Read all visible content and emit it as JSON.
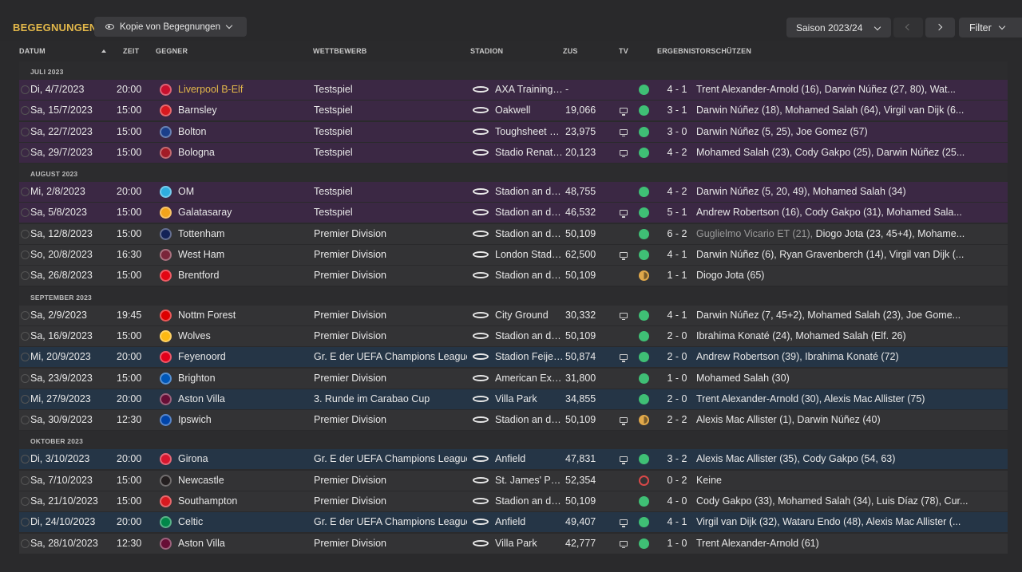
{
  "header": {
    "title": "BEGEGNUNGEN",
    "view_label": "Kopie von Begegnungen",
    "season_label": "Saison 2023/24",
    "filter_label": "Filter"
  },
  "columns": {
    "date": "DATUM",
    "time": "ZEIT",
    "opponent": "GEGNER",
    "competition": "WETTBEWERB",
    "stadium": "STADION",
    "attendance": "ZUS",
    "tv": "TV",
    "result": "ERGEBNIS",
    "scorers": "TORSCHÜTZEN"
  },
  "colors": {
    "friendly_row": "#3b2844",
    "league_row": "#333335",
    "cup_row": "#253546",
    "win": "#3fbf75",
    "draw": "#e0a84a",
    "loss": "#d84848",
    "accent": "#e3b84a"
  },
  "months": [
    {
      "label": "JULI 2023",
      "matches": [
        {
          "date": "Di, 4/7/2023",
          "time": "20:00",
          "opponent": "Liverpool B-Elf",
          "opponent_highlight": true,
          "crest_color": "#c8102e",
          "competition": "Testspiel",
          "kind": "friendly",
          "stadium": "AXA Training Centre",
          "attendance": "-",
          "tv": false,
          "result": "win",
          "score": "4 - 1",
          "scorers": "Trent Alexander-Arnold (16), Darwin Núñez (27, 80), Wat..."
        },
        {
          "date": "Sa, 15/7/2023",
          "time": "15:00",
          "opponent": "Barnsley",
          "crest_color": "#d71920",
          "competition": "Testspiel",
          "kind": "friendly",
          "stadium": "Oakwell",
          "attendance": "19,066",
          "tv": true,
          "result": "win",
          "score": "3 - 1",
          "scorers": "Darwin Núñez (18), Mohamed Salah (64), Virgil van Dijk (6..."
        },
        {
          "date": "Sa, 22/7/2023",
          "time": "15:00",
          "opponent": "Bolton",
          "crest_color": "#1b3f8b",
          "competition": "Testspiel",
          "kind": "friendly",
          "stadium": "Toughsheet Community Stadium",
          "attendance": "23,975",
          "tv": true,
          "result": "win",
          "score": "3 - 0",
          "scorers": "Darwin Núñez (5, 25), Joe Gomez (57)"
        },
        {
          "date": "Sa, 29/7/2023",
          "time": "15:00",
          "opponent": "Bologna",
          "crest_color": "#a21c26",
          "competition": "Testspiel",
          "kind": "friendly",
          "stadium": "Stadio Renato Dall'Ara",
          "attendance": "20,123",
          "tv": true,
          "result": "win",
          "score": "4 - 2",
          "scorers": "Mohamed Salah (23), Cody Gakpo (25), Darwin Núñez (25..."
        }
      ]
    },
    {
      "label": "AUGUST 2023",
      "matches": [
        {
          "date": "Mi, 2/8/2023",
          "time": "20:00",
          "opponent": "OM",
          "crest_color": "#2faee0",
          "competition": "Testspiel",
          "kind": "friendly",
          "stadium": "Stadion an der Anfield Road",
          "attendance": "48,755",
          "tv": false,
          "result": "win",
          "score": "4 - 2",
          "scorers": "Darwin Núñez (5, 20, 49), Mohamed Salah (34)"
        },
        {
          "date": "Sa, 5/8/2023",
          "time": "15:00",
          "opponent": "Galatasaray",
          "crest_color": "#f2a31b",
          "competition": "Testspiel",
          "kind": "friendly",
          "stadium": "Stadion an der Anfield Road",
          "attendance": "46,532",
          "tv": true,
          "result": "win",
          "score": "5 - 1",
          "scorers": "Andrew Robertson (16), Cody Gakpo (31), Mohamed Sala..."
        },
        {
          "date": "Sa, 12/8/2023",
          "time": "15:00",
          "opponent": "Tottenham",
          "crest_color": "#132257",
          "competition": "Premier Division",
          "kind": "league",
          "stadium": "Stadion an der Anfield Road",
          "attendance": "50,109",
          "tv": false,
          "result": "win",
          "score": "6 - 2",
          "own_goal": "Guglielmo Vicario ET (21), ",
          "scorers": "Diogo Jota (23, 45+4), Mohame..."
        },
        {
          "date": "So, 20/8/2023",
          "time": "16:30",
          "opponent": "West Ham",
          "crest_color": "#7a263a",
          "competition": "Premier Division",
          "kind": "league",
          "stadium": "London Stadium",
          "attendance": "62,500",
          "tv": true,
          "result": "win",
          "score": "4 - 1",
          "scorers": "Darwin Núñez (6), Ryan Gravenberch (14), Virgil van Dijk (..."
        },
        {
          "date": "Sa, 26/8/2023",
          "time": "15:00",
          "opponent": "Brentford",
          "crest_color": "#e30613",
          "competition": "Premier Division",
          "kind": "league",
          "stadium": "Stadion an der Anfield Road",
          "attendance": "50,109",
          "tv": false,
          "result": "draw",
          "score": "1 - 1",
          "scorers": "Diogo Jota (65)"
        }
      ]
    },
    {
      "label": "SEPTEMBER 2023",
      "matches": [
        {
          "date": "Sa, 2/9/2023",
          "time": "19:45",
          "opponent": "Nottm Forest",
          "crest_color": "#dd0000",
          "competition": "Premier Division",
          "kind": "league",
          "stadium": "City Ground",
          "attendance": "30,332",
          "tv": true,
          "result": "win",
          "score": "4 - 1",
          "scorers": "Darwin Núñez (7, 45+2), Mohamed Salah (23), Joe Gome..."
        },
        {
          "date": "Sa, 16/9/2023",
          "time": "15:00",
          "opponent": "Wolves",
          "crest_color": "#fdb913",
          "competition": "Premier Division",
          "kind": "league",
          "stadium": "Stadion an der Anfield Road",
          "attendance": "50,109",
          "tv": false,
          "result": "win",
          "score": "2 - 0",
          "scorers": "Ibrahima Konaté (24), Mohamed Salah (Elf. 26)"
        },
        {
          "date": "Mi, 20/9/2023",
          "time": "20:00",
          "opponent": "Feyenoord",
          "crest_color": "#e2001a",
          "competition": "Gr. E der UEFA Champions League",
          "kind": "cup",
          "stadium": "Stadion Feijenoord",
          "attendance": "50,874",
          "tv": true,
          "result": "win",
          "score": "2 - 0",
          "scorers": "Andrew Robertson (39), Ibrahima Konaté (72)"
        },
        {
          "date": "Sa, 23/9/2023",
          "time": "15:00",
          "opponent": "Brighton",
          "crest_color": "#0057b8",
          "competition": "Premier Division",
          "kind": "league",
          "stadium": "American Express Stadium",
          "attendance": "31,800",
          "tv": false,
          "result": "win",
          "score": "1 - 0",
          "scorers": "Mohamed Salah (30)"
        },
        {
          "date": "Mi, 27/9/2023",
          "time": "20:00",
          "opponent": "Aston Villa",
          "crest_color": "#670e36",
          "competition": "3. Runde im Carabao Cup",
          "kind": "cup",
          "stadium": "Villa Park",
          "attendance": "34,855",
          "tv": false,
          "result": "win",
          "score": "2 - 0",
          "scorers": "Trent Alexander-Arnold (30), Alexis Mac Allister (75)"
        },
        {
          "date": "Sa, 30/9/2023",
          "time": "12:30",
          "opponent": "Ipswich",
          "crest_color": "#0044a9",
          "competition": "Premier Division",
          "kind": "league",
          "stadium": "Stadion an der Anfield Road",
          "attendance": "50,109",
          "tv": true,
          "result": "draw",
          "score": "2 - 2",
          "scorers": "Alexis Mac Allister (1), Darwin Núñez (40)"
        }
      ]
    },
    {
      "label": "OKTOBER 2023",
      "matches": [
        {
          "date": "Di, 3/10/2023",
          "time": "20:00",
          "opponent": "Girona",
          "crest_color": "#d7172f",
          "competition": "Gr. E der UEFA Champions League",
          "kind": "cup",
          "stadium": "Anfield",
          "attendance": "47,831",
          "tv": true,
          "result": "win",
          "score": "3 - 2",
          "scorers": "Alexis Mac Allister (35), Cody Gakpo (54, 63)"
        },
        {
          "date": "Sa, 7/10/2023",
          "time": "15:00",
          "opponent": "Newcastle",
          "crest_color": "#241f20",
          "competition": "Premier Division",
          "kind": "league",
          "stadium": "St. James' Park",
          "attendance": "52,354",
          "tv": false,
          "result": "loss",
          "score": "0 - 2",
          "scorers": "Keine"
        },
        {
          "date": "Sa, 21/10/2023",
          "time": "15:00",
          "opponent": "Southampton",
          "crest_color": "#d71920",
          "competition": "Premier Division",
          "kind": "league",
          "stadium": "Stadion an der Anfield Road",
          "attendance": "50,109",
          "tv": false,
          "result": "win",
          "score": "4 - 0",
          "scorers": "Cody Gakpo (33), Mohamed Salah (34), Luis Díaz (78), Cur..."
        },
        {
          "date": "Di, 24/10/2023",
          "time": "20:00",
          "opponent": "Celtic",
          "crest_color": "#018749",
          "competition": "Gr. E der UEFA Champions League",
          "kind": "cup",
          "stadium": "Anfield",
          "attendance": "49,407",
          "tv": true,
          "result": "win",
          "score": "4 - 1",
          "scorers": "Virgil van Dijk (32), Wataru Endo (48), Alexis Mac Allister (..."
        },
        {
          "date": "Sa, 28/10/2023",
          "time": "12:30",
          "opponent": "Aston Villa",
          "crest_color": "#670e36",
          "competition": "Premier Division",
          "kind": "league",
          "stadium": "Villa Park",
          "attendance": "42,777",
          "tv": true,
          "result": "win",
          "score": "1 - 0",
          "scorers": "Trent Alexander-Arnold (61)"
        }
      ]
    }
  ]
}
